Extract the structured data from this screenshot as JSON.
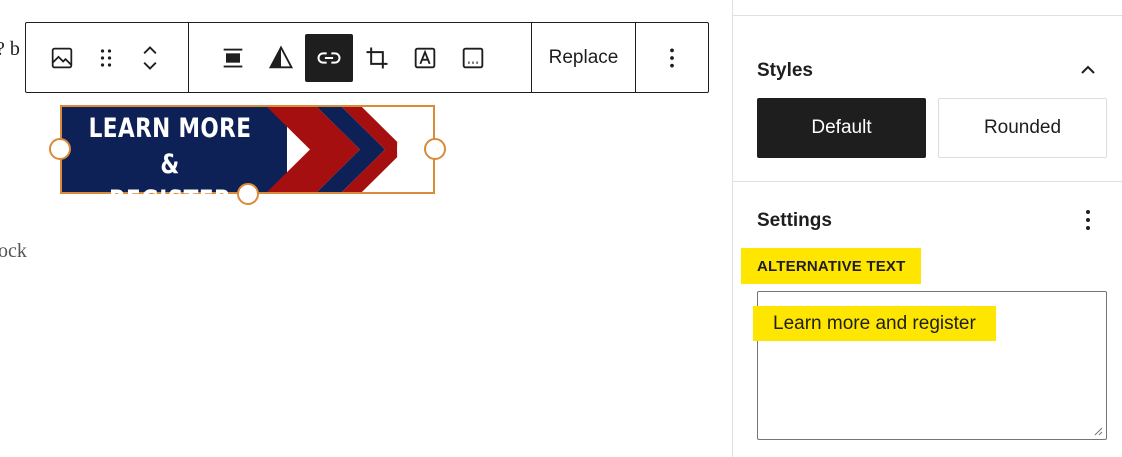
{
  "canvas": {
    "fragment_top": "? b",
    "fragment_bottom": "ock"
  },
  "toolbar": {
    "replace_label": "Replace"
  },
  "image": {
    "banner_line1": "LEARN MORE &",
    "banner_line2": "REGISTER",
    "colors": {
      "navy": "#0d2157",
      "red": "#a50f0f",
      "border": "#d98b3a"
    }
  },
  "sidebar": {
    "styles_title": "Styles",
    "style_default": "Default",
    "style_rounded": "Rounded",
    "settings_title": "Settings",
    "alt_label": "ALTERNATIVE TEXT",
    "alt_value": "Learn more and register"
  },
  "colors": {
    "highlight": "#ffe600",
    "dark": "#1e1e1e"
  }
}
